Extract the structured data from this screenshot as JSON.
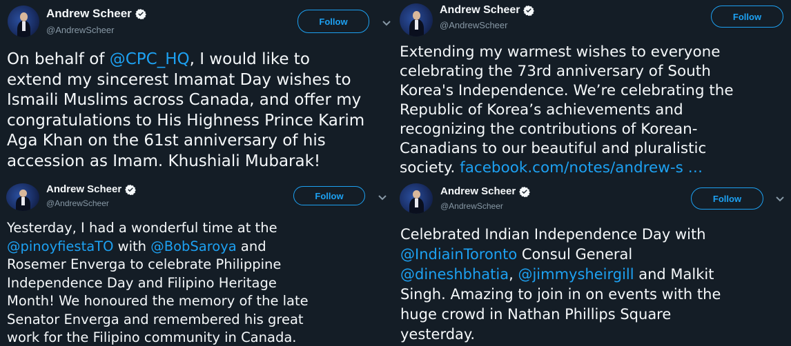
{
  "colors": {
    "background": "#141d26",
    "accent": "#1da1f2",
    "text": "#f5f8fa",
    "secondary": "#8899a6"
  },
  "tweets": [
    {
      "name": "Andrew Scheer",
      "handle": "@AndrewScheer",
      "follow_label": "Follow",
      "lines": [
        {
          "pre": "On behalf of ",
          "mention": "@CPC_HQ",
          "post": ", I would like to"
        },
        {
          "pre": "extend my sincerest Imamat Day wishes to"
        },
        {
          "pre": "Ismaili Muslims across Canada, and offer my"
        },
        {
          "pre": "congratulations to His Highness Prince Karim"
        },
        {
          "pre": "Aga Khan on the 61st anniversary of his"
        },
        {
          "pre": "accession as Imam. Khushiali Mubarak!"
        }
      ]
    },
    {
      "name": "Andrew Scheer",
      "handle": "@AndrewScheer",
      "follow_label": "Follow",
      "lines": [
        {
          "pre": "Extending my warmest wishes to everyone"
        },
        {
          "pre": "celebrating the 73rd anniversary of South"
        },
        {
          "pre": "Korea's Independence. We’re celebrating the"
        },
        {
          "pre": "Republic of Korea’s achievements and"
        },
        {
          "pre": "recognizing the contributions of Korean-"
        },
        {
          "pre": "Canadians to our beautiful and pluralistic"
        },
        {
          "pre": "society.  ",
          "link": "facebook.com/notes/andrew-s  …"
        }
      ]
    },
    {
      "name": "Andrew Scheer",
      "handle": "@AndrewScheer",
      "follow_label": "Follow",
      "lines": [
        {
          "pre": "Yesterday, I had a wonderful time at the"
        },
        {
          "mention": "@pinoyfiestaTO",
          "mid": " with ",
          "mention2": "@BobSaroya",
          "post": " and"
        },
        {
          "pre": "Rosemer Enverga to celebrate Philippine"
        },
        {
          "pre": "Independence Day and Filipino Heritage"
        },
        {
          "pre": "Month! We honoured the memory of the late"
        },
        {
          "pre": "Senator Enverga and remembered his great"
        },
        {
          "pre": "work for the Filipino community in Canada."
        }
      ]
    },
    {
      "name": "Andrew Scheer",
      "handle": "@AndrewScheer",
      "follow_label": "Follow",
      "lines": [
        {
          "pre": "Celebrated Indian Independence Day with"
        },
        {
          "mention": "@IndiainToronto",
          "post": " Consul General"
        },
        {
          "mention": "@dineshbhatia",
          "mid": ", ",
          "mention2": "@jimmysheirgill",
          "post": " and Malkit"
        },
        {
          "pre": "Singh. Amazing to join in on events with the"
        },
        {
          "pre": "huge crowd in Nathan Phillips Square"
        },
        {
          "pre": "yesterday."
        }
      ]
    }
  ]
}
